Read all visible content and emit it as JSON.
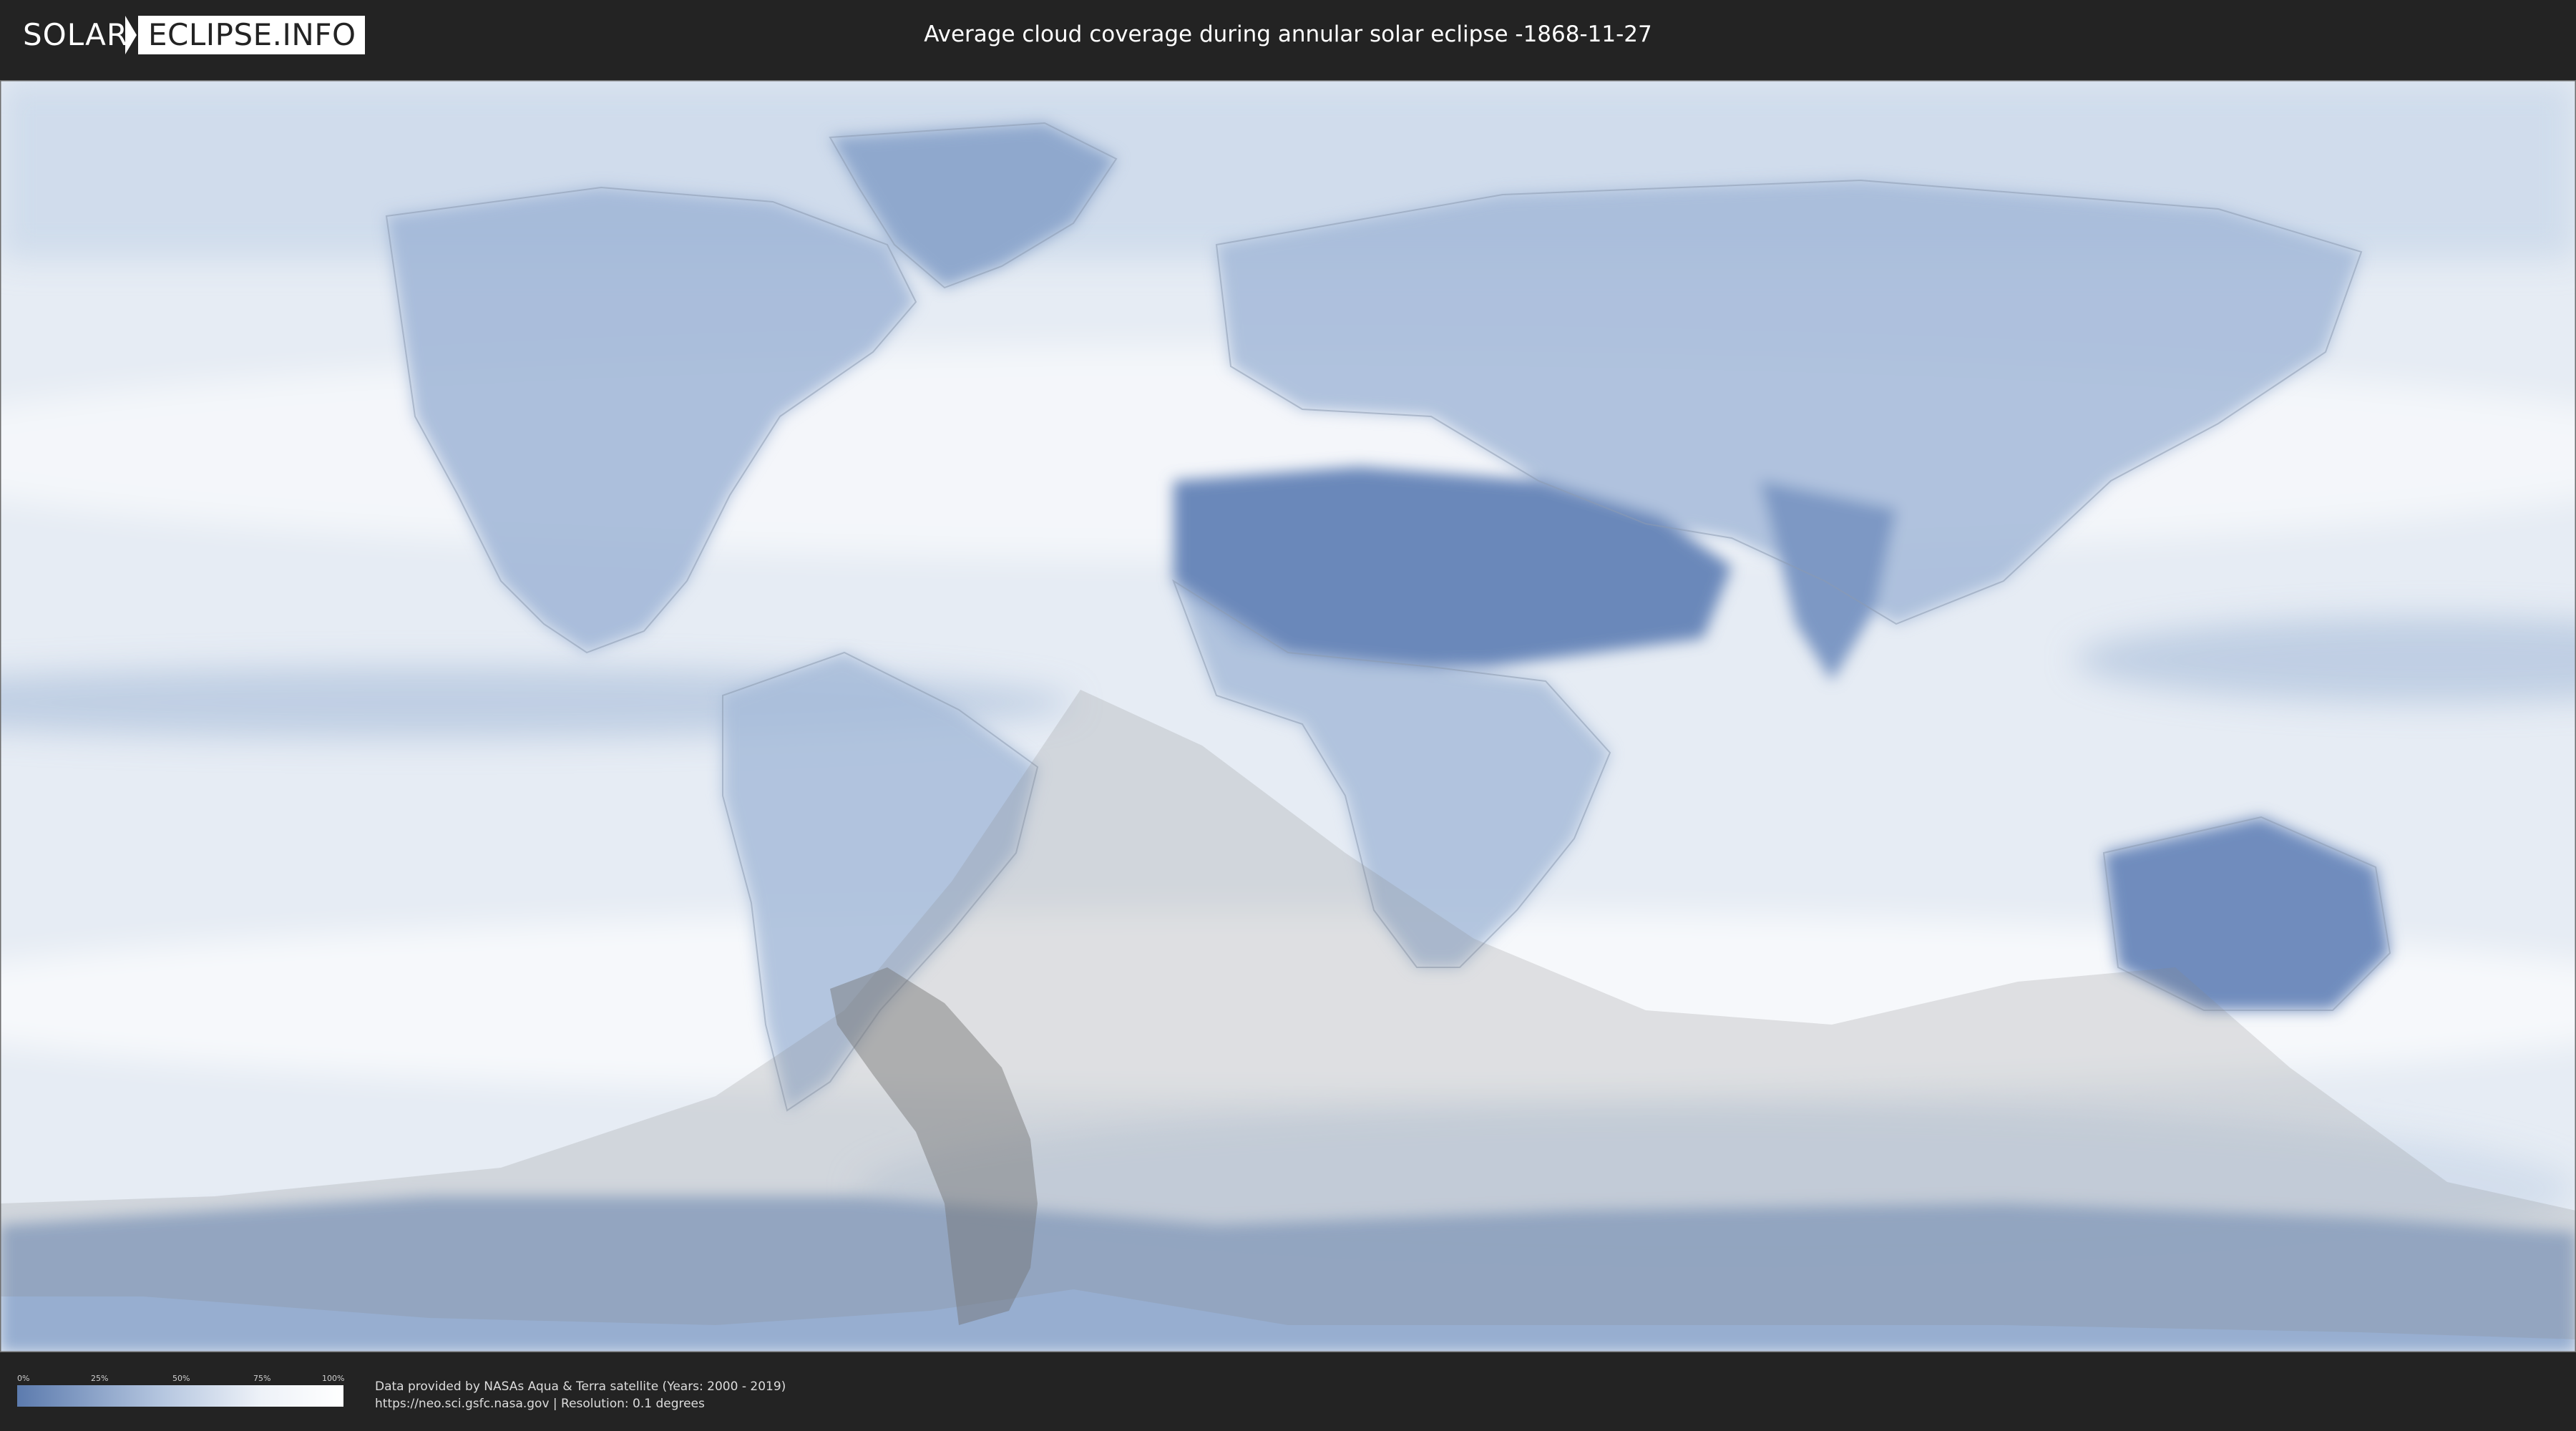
{
  "header": {
    "logo_left": "SOLAR",
    "logo_right": "ECLIPSE.INFO",
    "title": "Average cloud coverage during annular solar eclipse -1868-11-27"
  },
  "map": {
    "colors": {
      "ocean_base": "#e7edf5",
      "clear_sky": "#5c7bae",
      "cloud": "#ffffff",
      "eclipse_shadow": "#808080"
    }
  },
  "legend": {
    "ticks": [
      "0%",
      "25%",
      "50%",
      "75%",
      "100%"
    ],
    "colors": [
      "#5c7bae",
      "#ffffff"
    ]
  },
  "credits": {
    "line1": "Data provided by NASAs Aqua & Terra satellite (Years: 2000 - 2019)",
    "line2": "https://neo.sci.gsfc.nasa.gov | Resolution: 0.1 degrees"
  }
}
